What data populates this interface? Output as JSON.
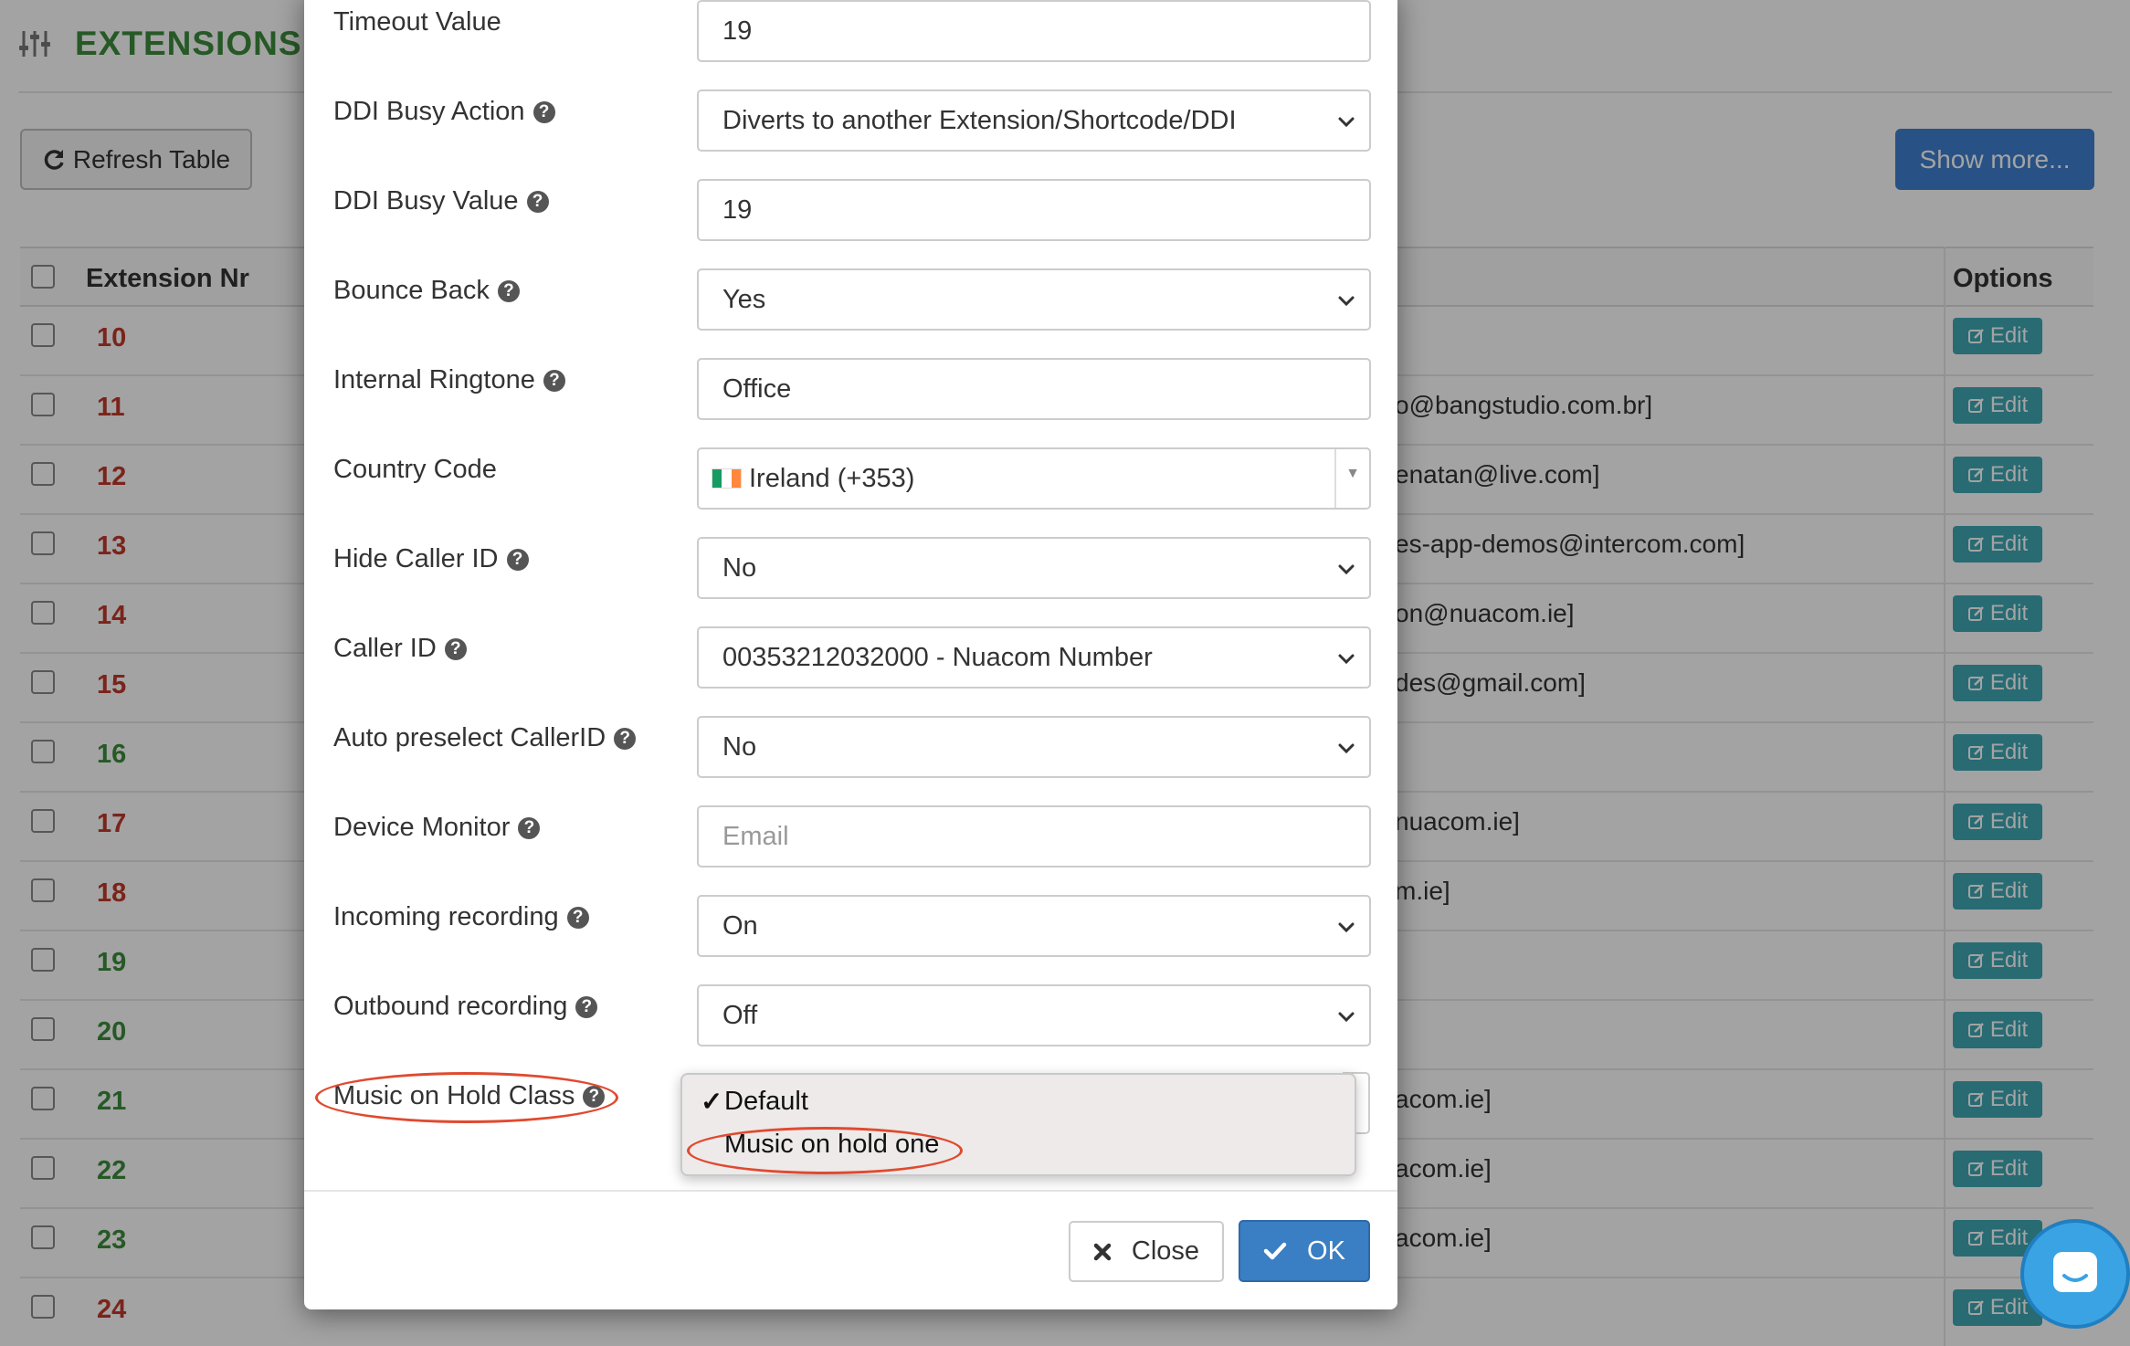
{
  "page": {
    "title": "EXTENSIONS",
    "refresh_label": "Refresh Table",
    "show_more_label": "Show more...",
    "table": {
      "col_extension": "Extension Nr",
      "col_options": "Options",
      "edit_label": "Edit",
      "rows": [
        {
          "ext": "10",
          "color": "red",
          "email": ""
        },
        {
          "ext": "11",
          "color": "red",
          "email": "o@bangstudio.com.br]"
        },
        {
          "ext": "12",
          "color": "red",
          "email": "enatan@live.com]"
        },
        {
          "ext": "13",
          "color": "red",
          "email": "es-app-demos@intercom.com]"
        },
        {
          "ext": "14",
          "color": "red",
          "email": "on@nuacom.ie]"
        },
        {
          "ext": "15",
          "color": "red",
          "email": "des@gmail.com]"
        },
        {
          "ext": "16",
          "color": "green",
          "email": ""
        },
        {
          "ext": "17",
          "color": "red",
          "email": "nuacom.ie]"
        },
        {
          "ext": "18",
          "color": "red",
          "email": "m.ie]"
        },
        {
          "ext": "19",
          "color": "green",
          "email": ""
        },
        {
          "ext": "20",
          "color": "green",
          "email": ""
        },
        {
          "ext": "21",
          "color": "green",
          "email": "acom.ie]"
        },
        {
          "ext": "22",
          "color": "green",
          "email": "acom.ie]"
        },
        {
          "ext": "23",
          "color": "green",
          "email": "acom.ie]"
        },
        {
          "ext": "24",
          "color": "red",
          "email": ""
        }
      ]
    }
  },
  "modal": {
    "fields": [
      {
        "label": "Timeout Value",
        "help": false,
        "type": "input",
        "value": "19"
      },
      {
        "label": "DDI Busy Action",
        "help": true,
        "type": "select",
        "value": "Diverts to another Extension/Shortcode/DDI"
      },
      {
        "label": "DDI Busy Value",
        "help": true,
        "type": "input",
        "value": "19"
      },
      {
        "label": "Bounce Back",
        "help": true,
        "type": "select",
        "value": "Yes"
      },
      {
        "label": "Internal Ringtone",
        "help": true,
        "type": "input",
        "value": "Office"
      },
      {
        "label": "Country Code",
        "help": false,
        "type": "country",
        "value": "Ireland (+353)"
      },
      {
        "label": "Hide Caller ID",
        "help": true,
        "type": "select",
        "value": "No"
      },
      {
        "label": "Caller ID",
        "help": true,
        "type": "select",
        "value": "00353212032000 - Nuacom Number"
      },
      {
        "label": "Auto preselect CallerID",
        "help": true,
        "type": "select",
        "value": "No"
      },
      {
        "label": "Device Monitor",
        "help": true,
        "type": "input",
        "value": "",
        "placeholder": "Email"
      },
      {
        "label": "Incoming recording",
        "help": true,
        "type": "select",
        "value": "On"
      },
      {
        "label": "Outbound recording",
        "help": true,
        "type": "select",
        "value": "Off"
      },
      {
        "label": "Music on Hold Class",
        "help": true,
        "type": "select-open",
        "value": "Default"
      }
    ],
    "dropdown_options": [
      {
        "label": "Default",
        "checked": true
      },
      {
        "label": "Music on hold one",
        "checked": false
      }
    ],
    "close_label": "Close",
    "ok_label": "OK"
  },
  "colors": {
    "accent_green": "#3c8c3c",
    "ext_red": "#c0392b",
    "edit_teal": "#3fa8b5",
    "ok_blue": "#3a7ec4",
    "annotation": "#e04a2f"
  }
}
